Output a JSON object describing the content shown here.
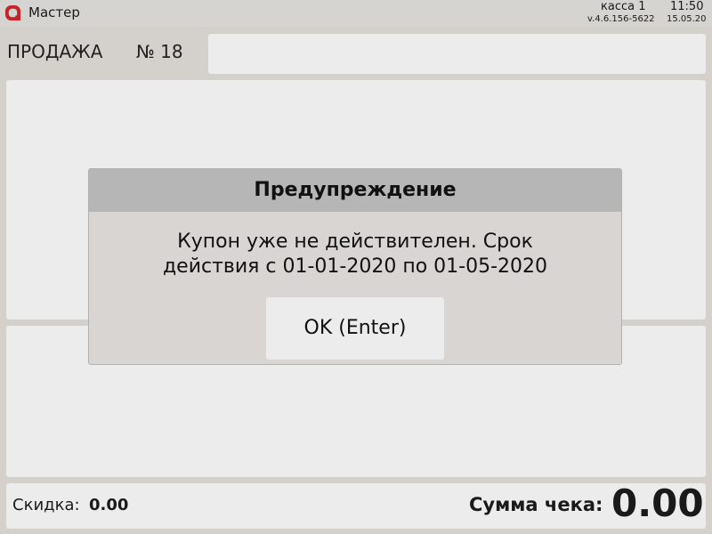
{
  "topbar": {
    "app_title": "Мастер",
    "register": "касса 1",
    "time": "11:50",
    "version": "v.4.6.156-5622",
    "date": "15.05.20",
    "logo_icon": "app-logo-icon",
    "logo_color": "#c8232a"
  },
  "sale": {
    "label": "ПРОДАЖА",
    "number": "№ 18"
  },
  "footer": {
    "discount_label": "Скидка:",
    "discount_value": "0.00",
    "total_label": "Сумма чека:",
    "total_value": "0.00"
  },
  "dialog": {
    "title": "Предупреждение",
    "message_line1": "Купон уже не действителен. Срок",
    "message_line2": "действия с 01-01-2020 по 01-05-2020",
    "ok_label": "OK (Enter)"
  }
}
